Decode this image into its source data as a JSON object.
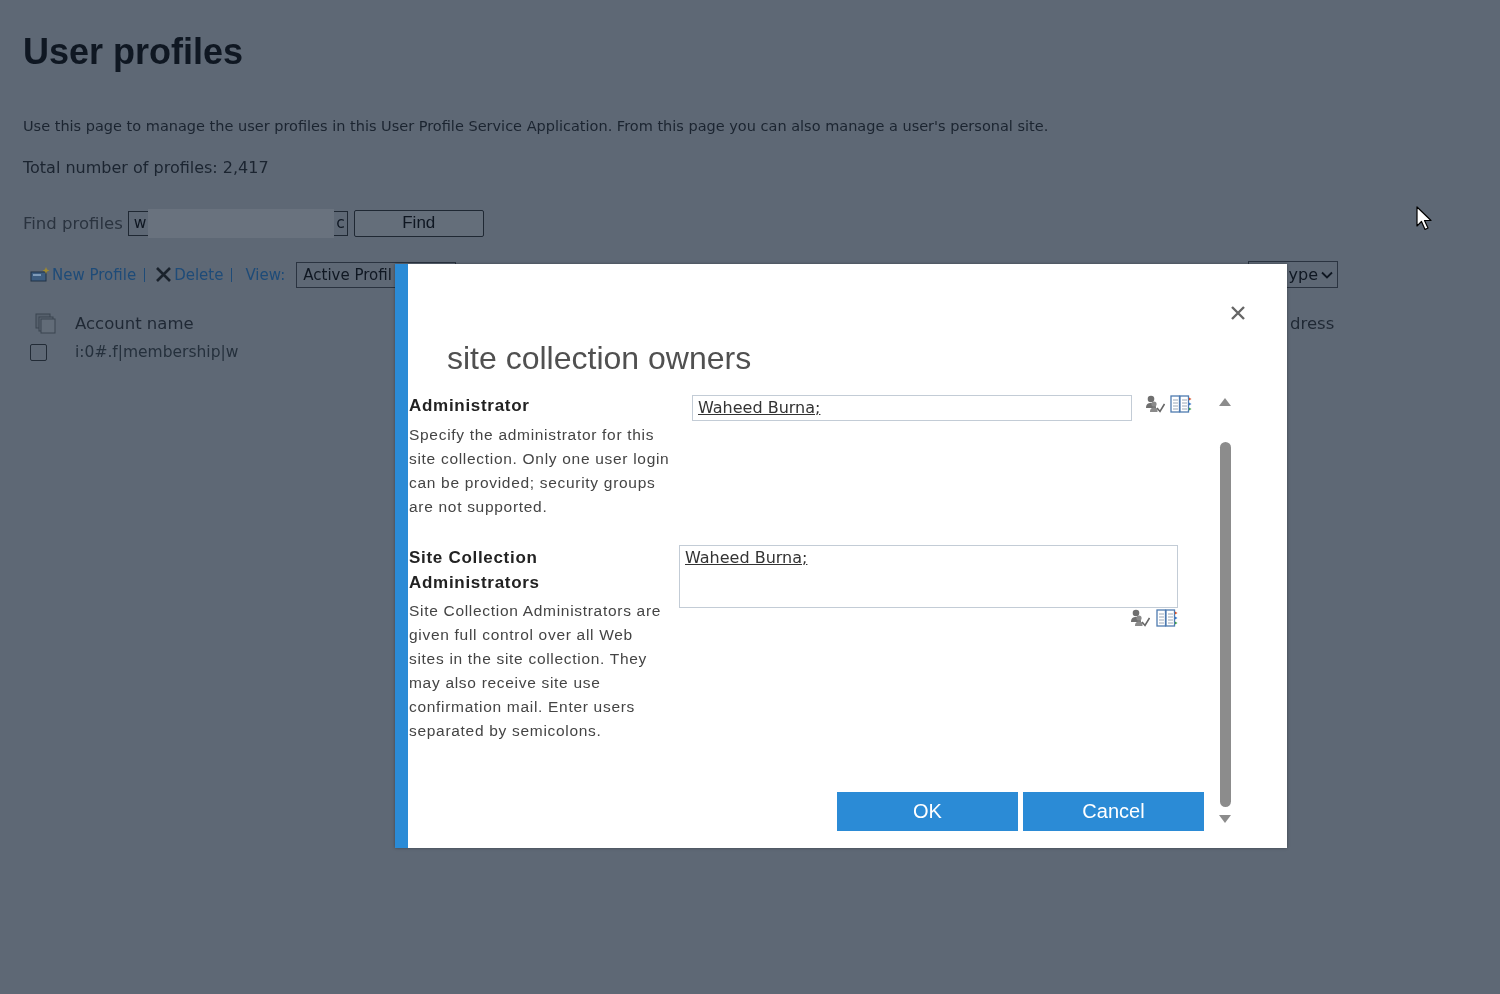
{
  "page": {
    "title": "User profiles",
    "description": "Use this page to manage the user profiles in this User Profile Service Application. From this page you can also manage a user's personal site.",
    "total": "Total number of profiles: 2,417"
  },
  "find": {
    "label": "Find profiles",
    "value_start": "w",
    "value_end": "c",
    "button": "Find"
  },
  "toolbar": {
    "actions": [
      {
        "kind": "new",
        "label": "New Profile"
      },
      {
        "kind": "delete",
        "label": "Delete"
      }
    ],
    "view_label": "View:",
    "view_value": "Active Profil",
    "filter_value": "ype"
  },
  "table": {
    "columns": [
      "Account name",
      "dress"
    ],
    "rows": [
      {
        "checked": false,
        "cells": [
          "i:0#.f|membership|w"
        ]
      }
    ]
  },
  "dialog": {
    "title": "site collection owners",
    "sections": [
      {
        "kind": "single",
        "heading": "Administrator",
        "description": "Specify the administrator for this site collection. Only one user login can be provided; security groups are not supported.",
        "value": "Waheed Burna;"
      },
      {
        "kind": "multi",
        "heading": "Site Collection Administrators",
        "description": "Site Collection Administrators are given full control over all Web sites in the site collection. They may also receive site use confirmation mail. Enter users separated by semicolons.",
        "value": "Waheed Burna;"
      }
    ],
    "buttons": [
      "OK",
      "Cancel"
    ]
  }
}
